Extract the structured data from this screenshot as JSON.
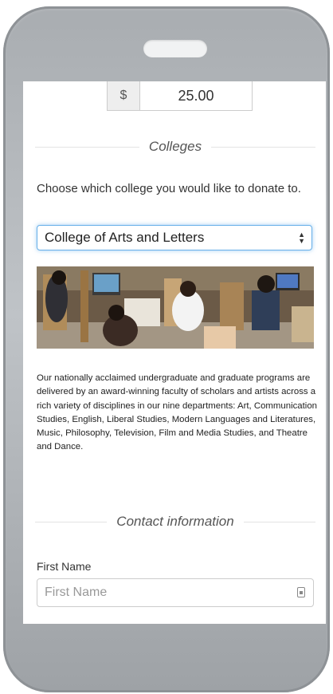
{
  "amount": {
    "currency_symbol": "$",
    "value": "25.00"
  },
  "colleges": {
    "heading": "Colleges",
    "prompt": "Choose which college you would like to donate to.",
    "selected": "College of Arts and Letters",
    "description": "Our nationally acclaimed undergraduate and graduate programs are delivered by an award-winning faculty of scholars and artists across a rich variety of disciplines in our nine departments: Art, Communication Studies, English, Liberal Studies, Modern Languages and Literatures, Music, Philosophy, Television, Film and Media Studies, and Theatre and Dance."
  },
  "contact": {
    "heading": "Contact information",
    "first_name_label": "First Name",
    "first_name_placeholder": "First Name"
  }
}
